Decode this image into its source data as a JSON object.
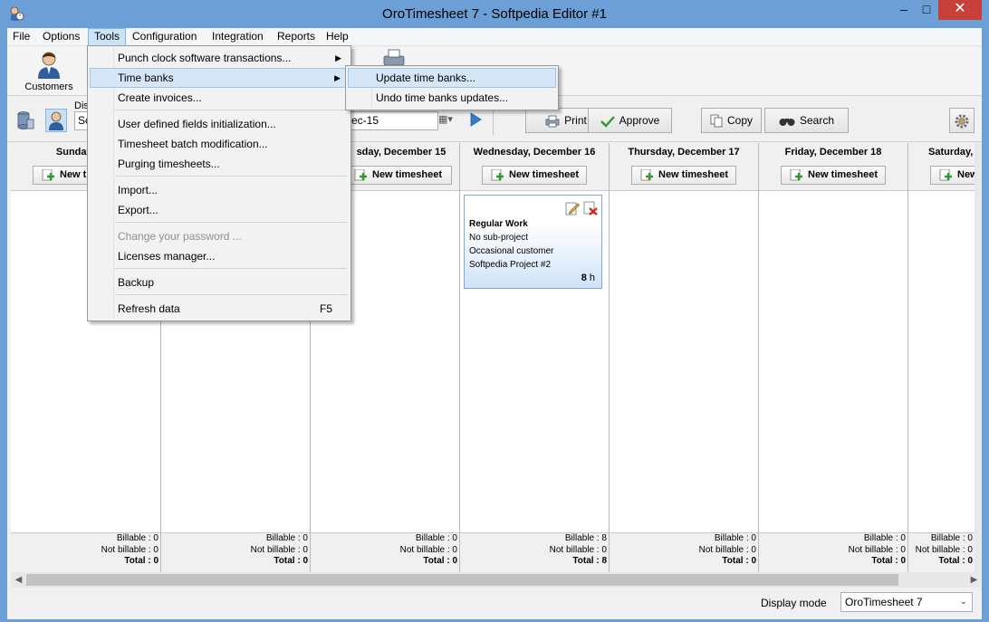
{
  "window": {
    "title": "OroTimesheet 7 - Softpedia Editor #1"
  },
  "menubar": {
    "items": [
      "File",
      "Options",
      "Tools",
      "Configuration",
      "Integration",
      "Reports",
      "Help"
    ]
  },
  "ribbon": {
    "customers_label": "Customers"
  },
  "toolbar": {
    "display_label": "Dis",
    "combo_value": "Sc",
    "date_value": "ec-15",
    "print": "Print",
    "approve": "Approve",
    "copy": "Copy",
    "search": "Search"
  },
  "days": [
    {
      "name": "Sunday, Dec",
      "new_label": "New t",
      "billable": "Billable : 0",
      "not_billable": "Not billable : 0",
      "total": "Total : 0"
    },
    {
      "name": "",
      "new_label": "",
      "billable": "Billable : 0",
      "not_billable": "Not billable : 0",
      "total": "Total : 0"
    },
    {
      "name": "sday, December 15",
      "new_label": "New timesheet",
      "billable": "Billable : 0",
      "not_billable": "Not billable : 0",
      "total": "Total : 0"
    },
    {
      "name": "Wednesday, December 16",
      "new_label": "New timesheet",
      "billable": "Billable : 8",
      "not_billable": "Not billable : 0",
      "total": "Total : 8"
    },
    {
      "name": "Thursday, December 17",
      "new_label": "New timesheet",
      "billable": "Billable : 0",
      "not_billable": "Not billable : 0",
      "total": "Total : 0"
    },
    {
      "name": "Friday, December 18",
      "new_label": "New timesheet",
      "billable": "Billable : 0",
      "not_billable": "Not billable : 0",
      "total": "Total : 0"
    },
    {
      "name": "Saturday, D",
      "new_label": "New t",
      "billable": "Billable : 0",
      "not_billable": "Not billable : 0",
      "total": "Total : 0"
    }
  ],
  "entry": {
    "title": "Regular Work",
    "line1": "No sub-project",
    "line2": "Occasional customer",
    "line3": "Softpedia Project #2",
    "hours": "8",
    "hours_unit": "h"
  },
  "tools_menu": {
    "items": [
      {
        "label": "Punch clock software transactions...",
        "submenu": true
      },
      {
        "label": "Time banks",
        "submenu": true,
        "highlighted": true
      },
      {
        "label": "Create invoices..."
      },
      {
        "label": "User defined fields initialization..."
      },
      {
        "label": "Timesheet batch modification..."
      },
      {
        "label": "Purging timesheets..."
      },
      {
        "label": "Import..."
      },
      {
        "label": "Export..."
      },
      {
        "label": "Change your password ...",
        "disabled": true
      },
      {
        "label": "Licenses manager..."
      },
      {
        "label": "Backup"
      },
      {
        "label": "Refresh data",
        "shortcut": "F5"
      }
    ]
  },
  "timebanks_menu": {
    "items": [
      {
        "label": "Update time banks...",
        "highlighted": true
      },
      {
        "label": "Undo time banks updates..."
      }
    ]
  },
  "status": {
    "display_mode_label": "Display mode",
    "display_mode_value": "OroTimesheet 7"
  },
  "colors": {
    "title_bar": "#6b9fd6",
    "close_button": "#c7403a",
    "menu_highlight": "#d5e6f7",
    "card_gradient": "#cfe3f7"
  }
}
